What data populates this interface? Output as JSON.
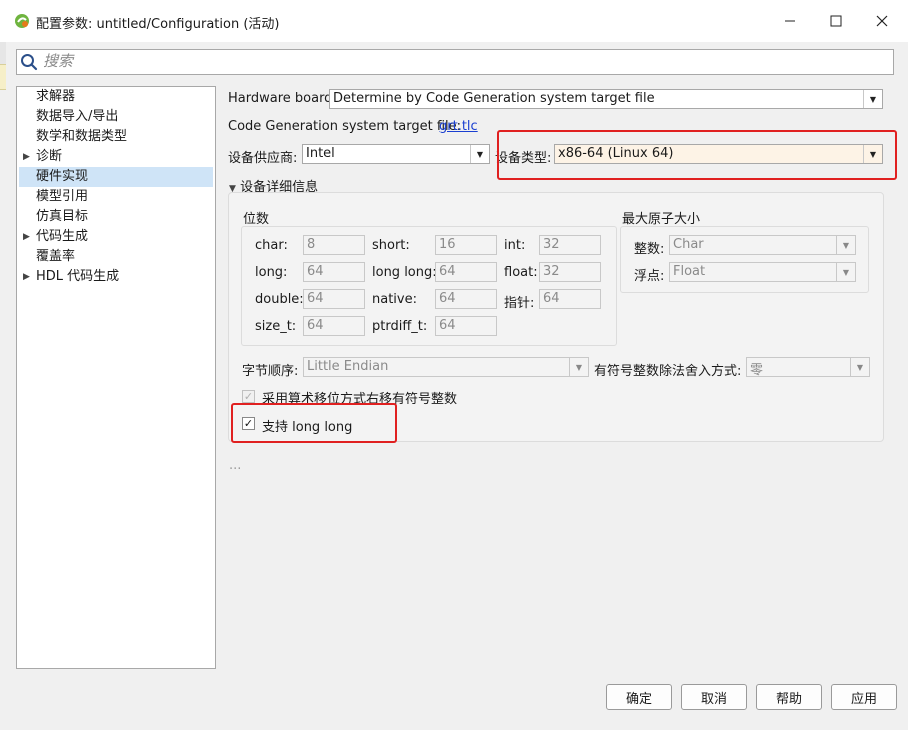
{
  "window": {
    "title": "配置参数: untitled/Configuration (活动)"
  },
  "search": {
    "placeholder": "搜索"
  },
  "tree": {
    "items": [
      {
        "label": "求解器",
        "expandable": false,
        "selected": false
      },
      {
        "label": "数据导入/导出",
        "expandable": false,
        "selected": false
      },
      {
        "label": "数学和数据类型",
        "expandable": false,
        "selected": false
      },
      {
        "label": "诊断",
        "expandable": true,
        "selected": false
      },
      {
        "label": "硬件实现",
        "expandable": false,
        "selected": true
      },
      {
        "label": "模型引用",
        "expandable": false,
        "selected": false
      },
      {
        "label": "仿真目标",
        "expandable": false,
        "selected": false
      },
      {
        "label": "代码生成",
        "expandable": true,
        "selected": false
      },
      {
        "label": "覆盖率",
        "expandable": false,
        "selected": false
      },
      {
        "label": "HDL 代码生成",
        "expandable": true,
        "selected": false
      }
    ]
  },
  "hardware": {
    "board_label": "Hardware board:",
    "board_value": "Determine by Code Generation system target file",
    "target_file_label": "Code Generation system target file:",
    "target_file_link": "grt.tlc",
    "vendor_label": "设备供应商:",
    "vendor_value": "Intel",
    "type_label": "设备类型:",
    "type_value": "x86-64 (Linux 64)",
    "details_label": "设备详细信息"
  },
  "bits": {
    "title": "位数",
    "rows": [
      [
        {
          "label": "char:",
          "value": "8"
        },
        {
          "label": "short:",
          "value": "16"
        },
        {
          "label": "int:",
          "value": "32"
        }
      ],
      [
        {
          "label": "long:",
          "value": "64"
        },
        {
          "label": "long long:",
          "value": "64"
        },
        {
          "label": "float:",
          "value": "32"
        }
      ],
      [
        {
          "label": "double:",
          "value": "64"
        },
        {
          "label": "native:",
          "value": "64"
        },
        {
          "label": "指针:",
          "value": "64"
        }
      ],
      [
        {
          "label": "size_t:",
          "value": "64"
        },
        {
          "label": "ptrdiff_t:",
          "value": "64"
        }
      ]
    ]
  },
  "atomic": {
    "title": "最大原子大小",
    "integer_label": "整数:",
    "integer_value": "Char",
    "float_label": "浮点:",
    "float_value": "Float"
  },
  "byte_order": {
    "label": "字节顺序:",
    "value": "Little Endian"
  },
  "rounding": {
    "label": "有符号整数除法舍入方式:",
    "value": "零"
  },
  "options": {
    "shift_label": "采用算术移位方式右移有符号整数",
    "shift_checked": true,
    "longlong_label": "支持 long long",
    "longlong_checked": true
  },
  "ellipsis": "...",
  "footer": {
    "ok": "确定",
    "cancel": "取消",
    "help": "帮助",
    "apply": "应用"
  },
  "colors": {
    "highlight_red": "#e02020",
    "selected_bg": "#cfe4f7",
    "link_blue": "#1a3fd1"
  }
}
